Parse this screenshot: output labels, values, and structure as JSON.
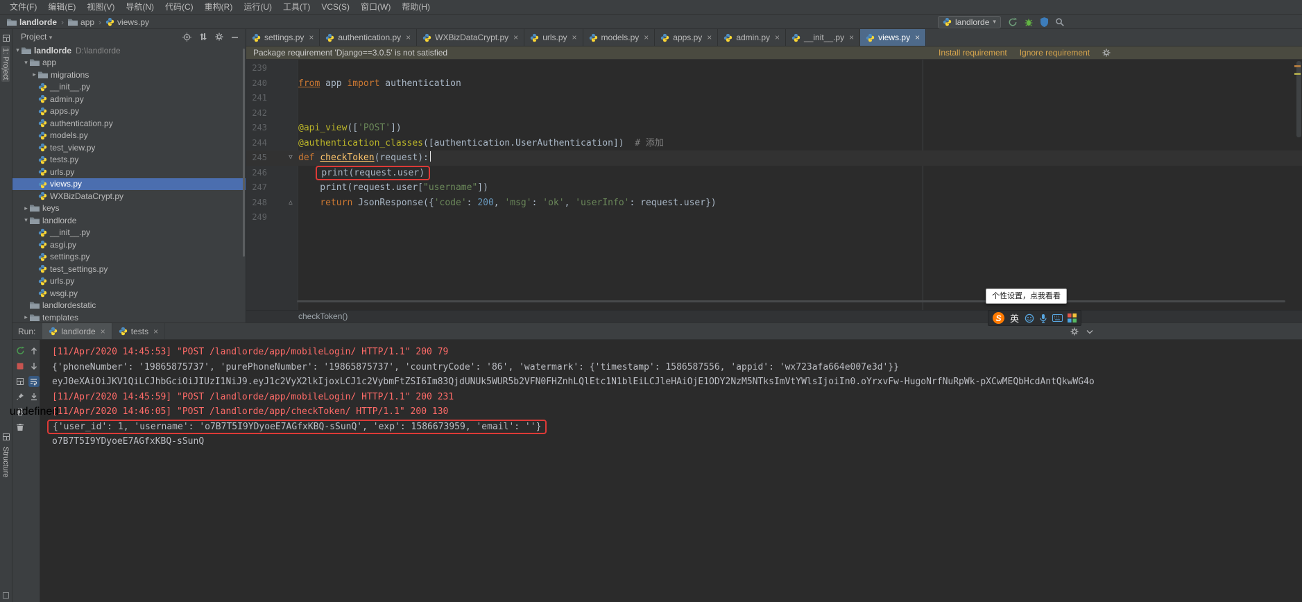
{
  "menu_bar": {
    "items": [
      "文件(F)",
      "编辑(E)",
      "视图(V)",
      "导航(N)",
      "代码(C)",
      "重构(R)",
      "运行(U)",
      "工具(T)",
      "VCS(S)",
      "窗口(W)",
      "帮助(H)"
    ]
  },
  "nav_bar": {
    "breadcrumbs": [
      {
        "label": "landlorde",
        "icon": "folder"
      },
      {
        "label": "app",
        "icon": "folder"
      },
      {
        "label": "views.py",
        "icon": "python"
      }
    ],
    "run_config": {
      "label": "landlorde"
    }
  },
  "tool_stripes": {
    "top_left": "1: Project",
    "bottom_left": "Structure"
  },
  "project_panel": {
    "title": "Project",
    "tree": [
      {
        "label": "landlorde",
        "extra": "D:\\landlorde",
        "type": "folder",
        "indent": 0,
        "arrow": "open",
        "bold": true
      },
      {
        "label": "app",
        "type": "folder",
        "indent": 1,
        "arrow": "open"
      },
      {
        "label": "migrations",
        "type": "folder",
        "indent": 2,
        "arrow": "closed"
      },
      {
        "label": "__init__.py",
        "type": "python",
        "indent": 2
      },
      {
        "label": "admin.py",
        "type": "python",
        "indent": 2
      },
      {
        "label": "apps.py",
        "type": "python",
        "indent": 2
      },
      {
        "label": "authentication.py",
        "type": "python",
        "indent": 2
      },
      {
        "label": "models.py",
        "type": "python",
        "indent": 2
      },
      {
        "label": "test_view.py",
        "type": "python",
        "indent": 2
      },
      {
        "label": "tests.py",
        "type": "python",
        "indent": 2
      },
      {
        "label": "urls.py",
        "type": "python",
        "indent": 2
      },
      {
        "label": "views.py",
        "type": "python",
        "indent": 2,
        "selected": true
      },
      {
        "label": "WXBizDataCrypt.py",
        "type": "python",
        "indent": 2
      },
      {
        "label": "keys",
        "type": "folder",
        "indent": 1,
        "arrow": "closed"
      },
      {
        "label": "landlorde",
        "type": "folder",
        "indent": 1,
        "arrow": "open"
      },
      {
        "label": "__init__.py",
        "type": "python",
        "indent": 2
      },
      {
        "label": "asgi.py",
        "type": "python",
        "indent": 2
      },
      {
        "label": "settings.py",
        "type": "python",
        "indent": 2
      },
      {
        "label": "test_settings.py",
        "type": "python",
        "indent": 2
      },
      {
        "label": "urls.py",
        "type": "python",
        "indent": 2
      },
      {
        "label": "wsgi.py",
        "type": "python",
        "indent": 2
      },
      {
        "label": "landlordestatic",
        "type": "folder",
        "indent": 1
      },
      {
        "label": "templates",
        "type": "folder",
        "indent": 1,
        "arrow": "closed"
      }
    ]
  },
  "editor": {
    "tabs": [
      {
        "label": "settings.py"
      },
      {
        "label": "authentication.py"
      },
      {
        "label": "WXBizDataCrypt.py"
      },
      {
        "label": "urls.py"
      },
      {
        "label": "models.py"
      },
      {
        "label": "apps.py"
      },
      {
        "label": "admin.py"
      },
      {
        "label": "__init__.py"
      },
      {
        "label": "views.py",
        "active": true
      }
    ],
    "banner": {
      "text": "Package requirement 'Django==3.0.5' is not satisfied",
      "links": [
        "Install requirement",
        "Ignore requirement"
      ]
    },
    "code": {
      "lines": [
        {
          "num": 239,
          "segs": []
        },
        {
          "num": 240,
          "segs": [
            {
              "t": "from",
              "c": "kw u"
            },
            {
              "t": " app ",
              "c": "d"
            },
            {
              "t": "import",
              "c": "kw"
            },
            {
              "t": " authentication",
              "c": "d"
            }
          ]
        },
        {
          "num": 241,
          "segs": []
        },
        {
          "num": 242,
          "segs": []
        },
        {
          "num": 243,
          "segs": [
            {
              "t": "@api_view",
              "c": "dec"
            },
            {
              "t": "([",
              "c": "d"
            },
            {
              "t": "'POST'",
              "c": "str"
            },
            {
              "t": "])",
              "c": "d"
            }
          ]
        },
        {
          "num": 244,
          "segs": [
            {
              "t": "@authentication_classes",
              "c": "dec"
            },
            {
              "t": "([authentication.UserAuthentication])",
              "c": "d"
            },
            {
              "t": "  # 添加",
              "c": "com"
            }
          ]
        },
        {
          "num": 245,
          "current": true,
          "fold": "open",
          "caret": true,
          "segs": [
            {
              "t": "def ",
              "c": "kw"
            },
            {
              "t": "checkToken",
              "c": "fn u"
            },
            {
              "t": "(request):",
              "c": "d"
            }
          ]
        },
        {
          "num": 246,
          "segs": [
            {
              "t": "    ",
              "c": "d"
            },
            {
              "t": "print(request.user)",
              "c": "d",
              "box": true
            }
          ]
        },
        {
          "num": 247,
          "segs": [
            {
              "t": "    print(request.user[",
              "c": "d"
            },
            {
              "t": "\"username\"",
              "c": "str"
            },
            {
              "t": "])",
              "c": "d"
            }
          ]
        },
        {
          "num": 248,
          "fold": "close",
          "segs": [
            {
              "t": "    ",
              "c": "d"
            },
            {
              "t": "return",
              "c": "kw"
            },
            {
              "t": " JsonResponse({",
              "c": "d"
            },
            {
              "t": "'code'",
              "c": "str"
            },
            {
              "t": ": ",
              "c": "d"
            },
            {
              "t": "200",
              "c": "num"
            },
            {
              "t": ", ",
              "c": "d"
            },
            {
              "t": "'msg'",
              "c": "str"
            },
            {
              "t": ": ",
              "c": "d"
            },
            {
              "t": "'ok'",
              "c": "str"
            },
            {
              "t": ", ",
              "c": "d"
            },
            {
              "t": "'userInfo'",
              "c": "str"
            },
            {
              "t": ": request.user})",
              "c": "d"
            }
          ]
        },
        {
          "num": 249,
          "segs": []
        }
      ]
    },
    "breadcrumb": "checkToken()"
  },
  "run_panel": {
    "label": "Run:",
    "tabs": [
      {
        "label": "landlorde",
        "active": true
      },
      {
        "label": "tests"
      }
    ],
    "console": [
      {
        "kind": "err",
        "text": "[11/Apr/2020 14:45:53] \"POST /landlorde/app/mobileLogin/ HTTP/1.1\" 200 79"
      },
      {
        "kind": "out",
        "text": "{'phoneNumber': '19865875737', 'purePhoneNumber': '19865875737', 'countryCode': '86', 'watermark': {'timestamp': 1586587556, 'appid': 'wx723afa664e007e3d'}}"
      },
      {
        "kind": "out",
        "text": "eyJ0eXAiOiJKV1QiLCJhbGciOiJIUzI1NiJ9.eyJ1c2VyX2lkIjoxLCJ1c2VybmFtZSI6Im83QjdUNUk5WUR5b2VFN0FHZnhLQlEtc1N1blEiLCJleHAiOjE1ODY2NzM5NTksImVtYWlsIjoiIn0.oYrxvFw-HugoNrfNuRpWk-pXCwMEQbHcdAntQkwWG4o"
      },
      {
        "kind": "err",
        "text": "[11/Apr/2020 14:45:59] \"POST /landlorde/app/mobileLogin/ HTTP/1.1\" 200 231"
      },
      {
        "kind": "err",
        "text": "[11/Apr/2020 14:46:05] \"POST /landlorde/app/checkToken/ HTTP/1.1\" 200 130"
      },
      {
        "kind": "out",
        "boxed": true,
        "text": "{'user_id': 1, 'username': 'o7B7T5I9YDyoeE7AGfxKBQ-sSunQ', 'exp': 1586673959, 'email': ''}"
      },
      {
        "kind": "out",
        "text": "o7B7T5I9YDyoeE7AGfxKBQ-sSunQ"
      }
    ]
  },
  "ime": {
    "tooltip": "个性设置，点我看看",
    "lang": "英",
    "logo": "S"
  },
  "glyphs": {
    "tree_open": "▾",
    "tree_closed": "▸",
    "fold_open": "▽",
    "fold_close": "△",
    "crumb_sep": "›",
    "close": "×",
    "dropdown": "▾"
  },
  "colors": {
    "selection": "#4b6eaf",
    "console_error": "#ff6b68",
    "annotation_box": "#dd3a37",
    "banner_link": "#d8a64e",
    "active_tab": "#4e6a8a"
  }
}
